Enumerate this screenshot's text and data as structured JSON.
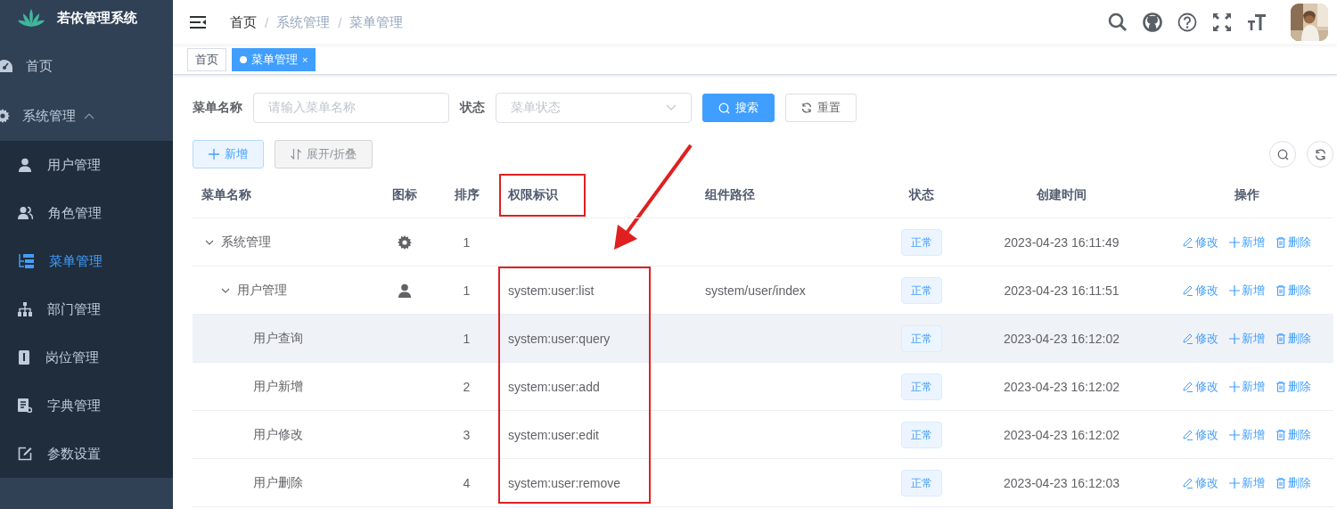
{
  "sidebar": {
    "title": "若依管理系统",
    "menu": [
      {
        "label": "首页",
        "selected": false
      },
      {
        "label": "系统管理",
        "expanded": true,
        "children": [
          {
            "label": "用户管理",
            "selected": false
          },
          {
            "label": "角色管理",
            "selected": false
          },
          {
            "label": "菜单管理",
            "selected": true
          },
          {
            "label": "部门管理",
            "selected": false
          },
          {
            "label": "岗位管理",
            "selected": false
          },
          {
            "label": "字典管理",
            "selected": false
          },
          {
            "label": "参数设置",
            "selected": false
          }
        ]
      }
    ]
  },
  "navbar": {
    "breadcrumb": [
      {
        "label": "首页"
      },
      {
        "label": "系统管理"
      },
      {
        "label": "菜单管理"
      }
    ],
    "separator": "/"
  },
  "tags": [
    {
      "label": "首页",
      "selected": false
    },
    {
      "label": "菜单管理",
      "selected": true,
      "close": "×"
    }
  ],
  "search_form": {
    "fields": [
      {
        "label": "菜单名称",
        "placeholder": "请输入菜单名称",
        "kind": "input"
      },
      {
        "label": "状态",
        "placeholder": "菜单状态",
        "kind": "select"
      }
    ],
    "buttons": [
      {
        "label": "搜索",
        "kind": "primary"
      },
      {
        "label": "重置",
        "kind": "default"
      }
    ]
  },
  "toolbar": {
    "buttons": [
      {
        "label": "新增",
        "kind": "add"
      },
      {
        "label": "展开/折叠",
        "kind": "toggle"
      }
    ]
  },
  "table": {
    "columns": [
      {
        "label": "菜单名称",
        "highlighted": false
      },
      {
        "label": "图标",
        "highlighted": false
      },
      {
        "label": "排序",
        "highlighted": false
      },
      {
        "label": "权限标识",
        "highlighted": true
      },
      {
        "label": "组件路径",
        "highlighted": false
      },
      {
        "label": "状态",
        "highlighted": false
      },
      {
        "label": "创建时间",
        "highlighted": false
      },
      {
        "label": "操作",
        "highlighted": false
      }
    ],
    "rows": [
      {
        "name": "系统管理",
        "kind": "directory",
        "expanded": true,
        "order": "1",
        "status": "正常",
        "created": "2023-04-23 16:11:49",
        "actions": [
          "修改",
          "新增",
          "删除"
        ],
        "hovered": false,
        "children": [
          {
            "name": "用户管理",
            "kind": "menu",
            "expanded": true,
            "order": "1",
            "perms": "system:user:list",
            "component": "system/user/index",
            "status": "正常",
            "created": "2023-04-23 16:11:51",
            "actions": [
              "修改",
              "新增",
              "删除"
            ],
            "hovered": false,
            "children": [
              {
                "name": "用户查询",
                "order": "1",
                "perms": "system:user:query",
                "status": "正常",
                "created": "2023-04-23 16:12:02",
                "actions": [
                  "修改",
                  "新增",
                  "删除"
                ],
                "hovered": true
              },
              {
                "name": "用户新增",
                "order": "2",
                "perms": "system:user:add",
                "status": "正常",
                "created": "2023-04-23 16:12:02",
                "actions": [
                  "修改",
                  "新增",
                  "删除"
                ],
                "hovered": false
              },
              {
                "name": "用户修改",
                "order": "3",
                "perms": "system:user:edit",
                "status": "正常",
                "created": "2023-04-23 16:12:02",
                "actions": [
                  "修改",
                  "新增",
                  "删除"
                ],
                "hovered": false
              },
              {
                "name": "用户删除",
                "order": "4",
                "perms": "system:user:remove",
                "status": "正常",
                "created": "2023-04-23 16:12:03",
                "actions": [
                  "修改",
                  "新增",
                  "删除"
                ],
                "hovered": false
              }
            ]
          }
        ]
      }
    ]
  }
}
